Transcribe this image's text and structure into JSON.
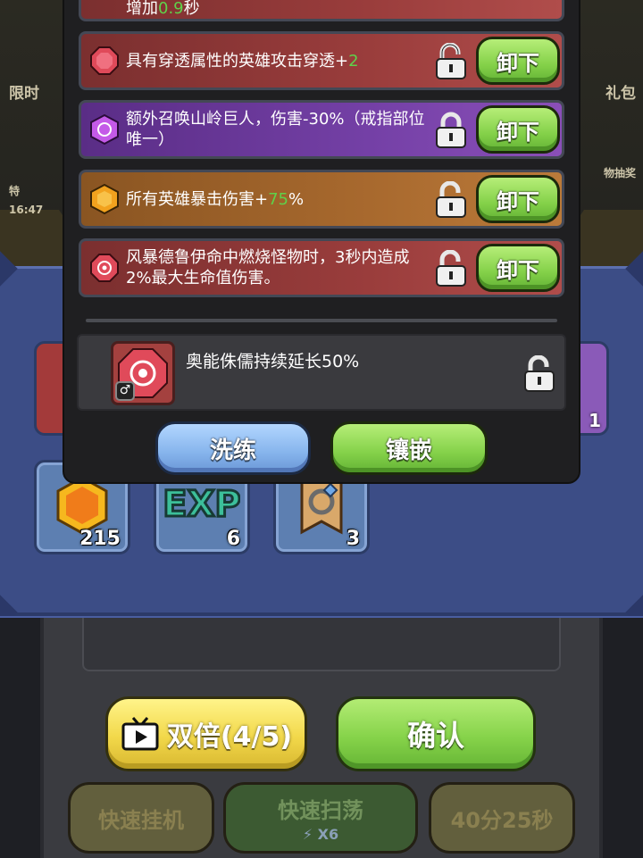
{
  "background": {
    "left_promo": "限时",
    "left_promo_sub": "特",
    "left_timer": "16:47",
    "right_promo": "礼包",
    "right_promo_sub": "物抽奖",
    "items": [
      {
        "icon": "gold-coin-icon",
        "count": "215"
      },
      {
        "icon": "exp-icon",
        "count": "6"
      },
      {
        "icon": "ring-scroll-icon",
        "count": "3"
      }
    ],
    "left_side_item_count": "1",
    "right_side_item_count": "1",
    "double_button": "双倍(4/5)",
    "confirm_button": "确认",
    "quick_idle_button": "快速挂机",
    "quick_sweep_button": "快速扫荡",
    "quick_sweep_cost": "X6",
    "timer_button": "40分25秒"
  },
  "popup": {
    "partial_affix": {
      "prefix": "增加",
      "value": "0.9",
      "suffix": "秒"
    },
    "affixes": [
      {
        "color": "red",
        "gem": "red-gem-icon",
        "text": "具有穿透属性的英雄攻击穿透+",
        "value": "2",
        "suffix": "",
        "locked": false,
        "button": "卸下"
      },
      {
        "color": "purple",
        "gem": "purple-gem-icon",
        "text": "额外召唤山岭巨人，伤害-30%（戒指部位唯一）",
        "value": "",
        "suffix": "",
        "locked": true,
        "button": "卸下"
      },
      {
        "color": "orange",
        "gem": "orange-gem-icon",
        "text": "所有英雄暴击伤害+",
        "value": "75",
        "suffix": "%",
        "locked": false,
        "button": "卸下"
      },
      {
        "color": "red",
        "gem": "red-swirl-gem-icon",
        "text": "风暴德鲁伊命中燃烧怪物时，3秒内造成2%最大生命值伤害。",
        "value": "",
        "suffix": "",
        "locked": false,
        "button": "卸下"
      }
    ],
    "reroll_text": "奥能侏儒持续延长50%",
    "refine_button": "洗练",
    "inlay_button": "镶嵌"
  }
}
